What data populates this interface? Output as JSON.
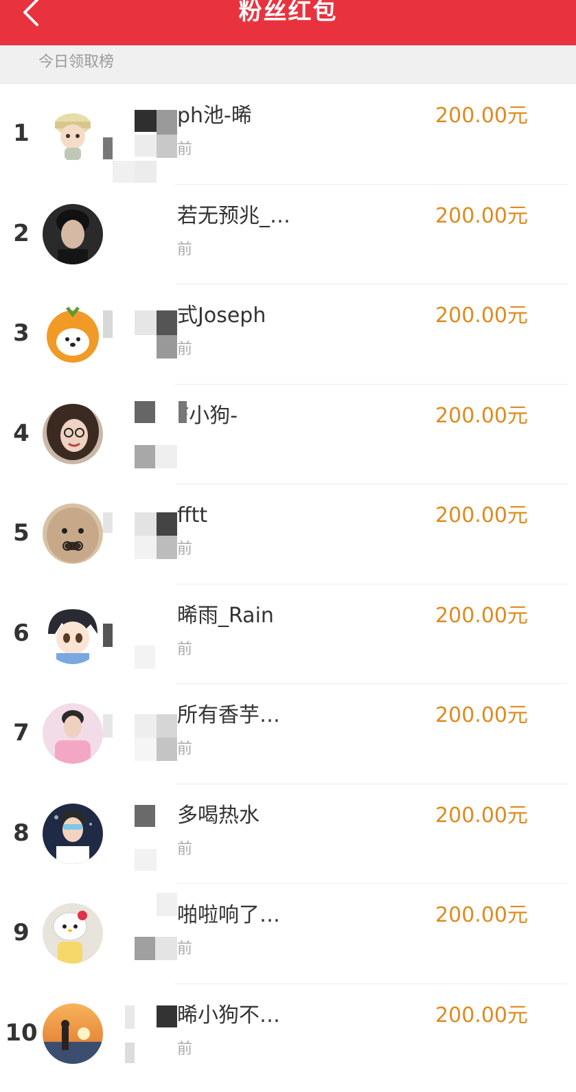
{
  "header": {
    "title": "粉丝红包",
    "back_icon": "chevron-left-icon",
    "background_color": "#e8333f"
  },
  "section": {
    "label": "今日领取榜"
  },
  "colors": {
    "amount": "#e08a1e",
    "rank": "#333333",
    "time": "#aaaaaa"
  },
  "entries": [
    {
      "rank": "1",
      "name": "ph池-晞",
      "time": "前",
      "amount": "200.00元",
      "avatar": "cartoon-boy-avatar"
    },
    {
      "rank": "2",
      "name": "若无预兆_…",
      "time": "前",
      "amount": "200.00元",
      "avatar": "man-portrait-avatar"
    },
    {
      "rank": "3",
      "name": "式Joseph",
      "time": "前",
      "amount": "200.00元",
      "avatar": "orange-bear-avatar"
    },
    {
      "rank": "4",
      "name": "F小狗-",
      "time": "",
      "amount": "200.00元",
      "avatar": "girl-glasses-avatar"
    },
    {
      "rank": "5",
      "name": "fftt",
      "time": "前",
      "amount": "200.00元",
      "avatar": "plush-toy-avatar"
    },
    {
      "rank": "6",
      "name": "晞雨_Rain",
      "time": "前",
      "amount": "200.00元",
      "avatar": "anime-boy-avatar"
    },
    {
      "rank": "7",
      "name": "所有香芋…",
      "time": "前",
      "amount": "200.00元",
      "avatar": "pink-shirt-man-avatar"
    },
    {
      "rank": "8",
      "name": "多喝热水",
      "time": "前",
      "amount": "200.00元",
      "avatar": "man-sunglasses-avatar"
    },
    {
      "rank": "9",
      "name": "啪啦响了…",
      "time": "前",
      "amount": "200.00元",
      "avatar": "hello-kitty-avatar"
    },
    {
      "rank": "10",
      "name": "晞小狗不…",
      "time": "前",
      "amount": "200.00元",
      "avatar": "sunset-beach-avatar"
    }
  ]
}
